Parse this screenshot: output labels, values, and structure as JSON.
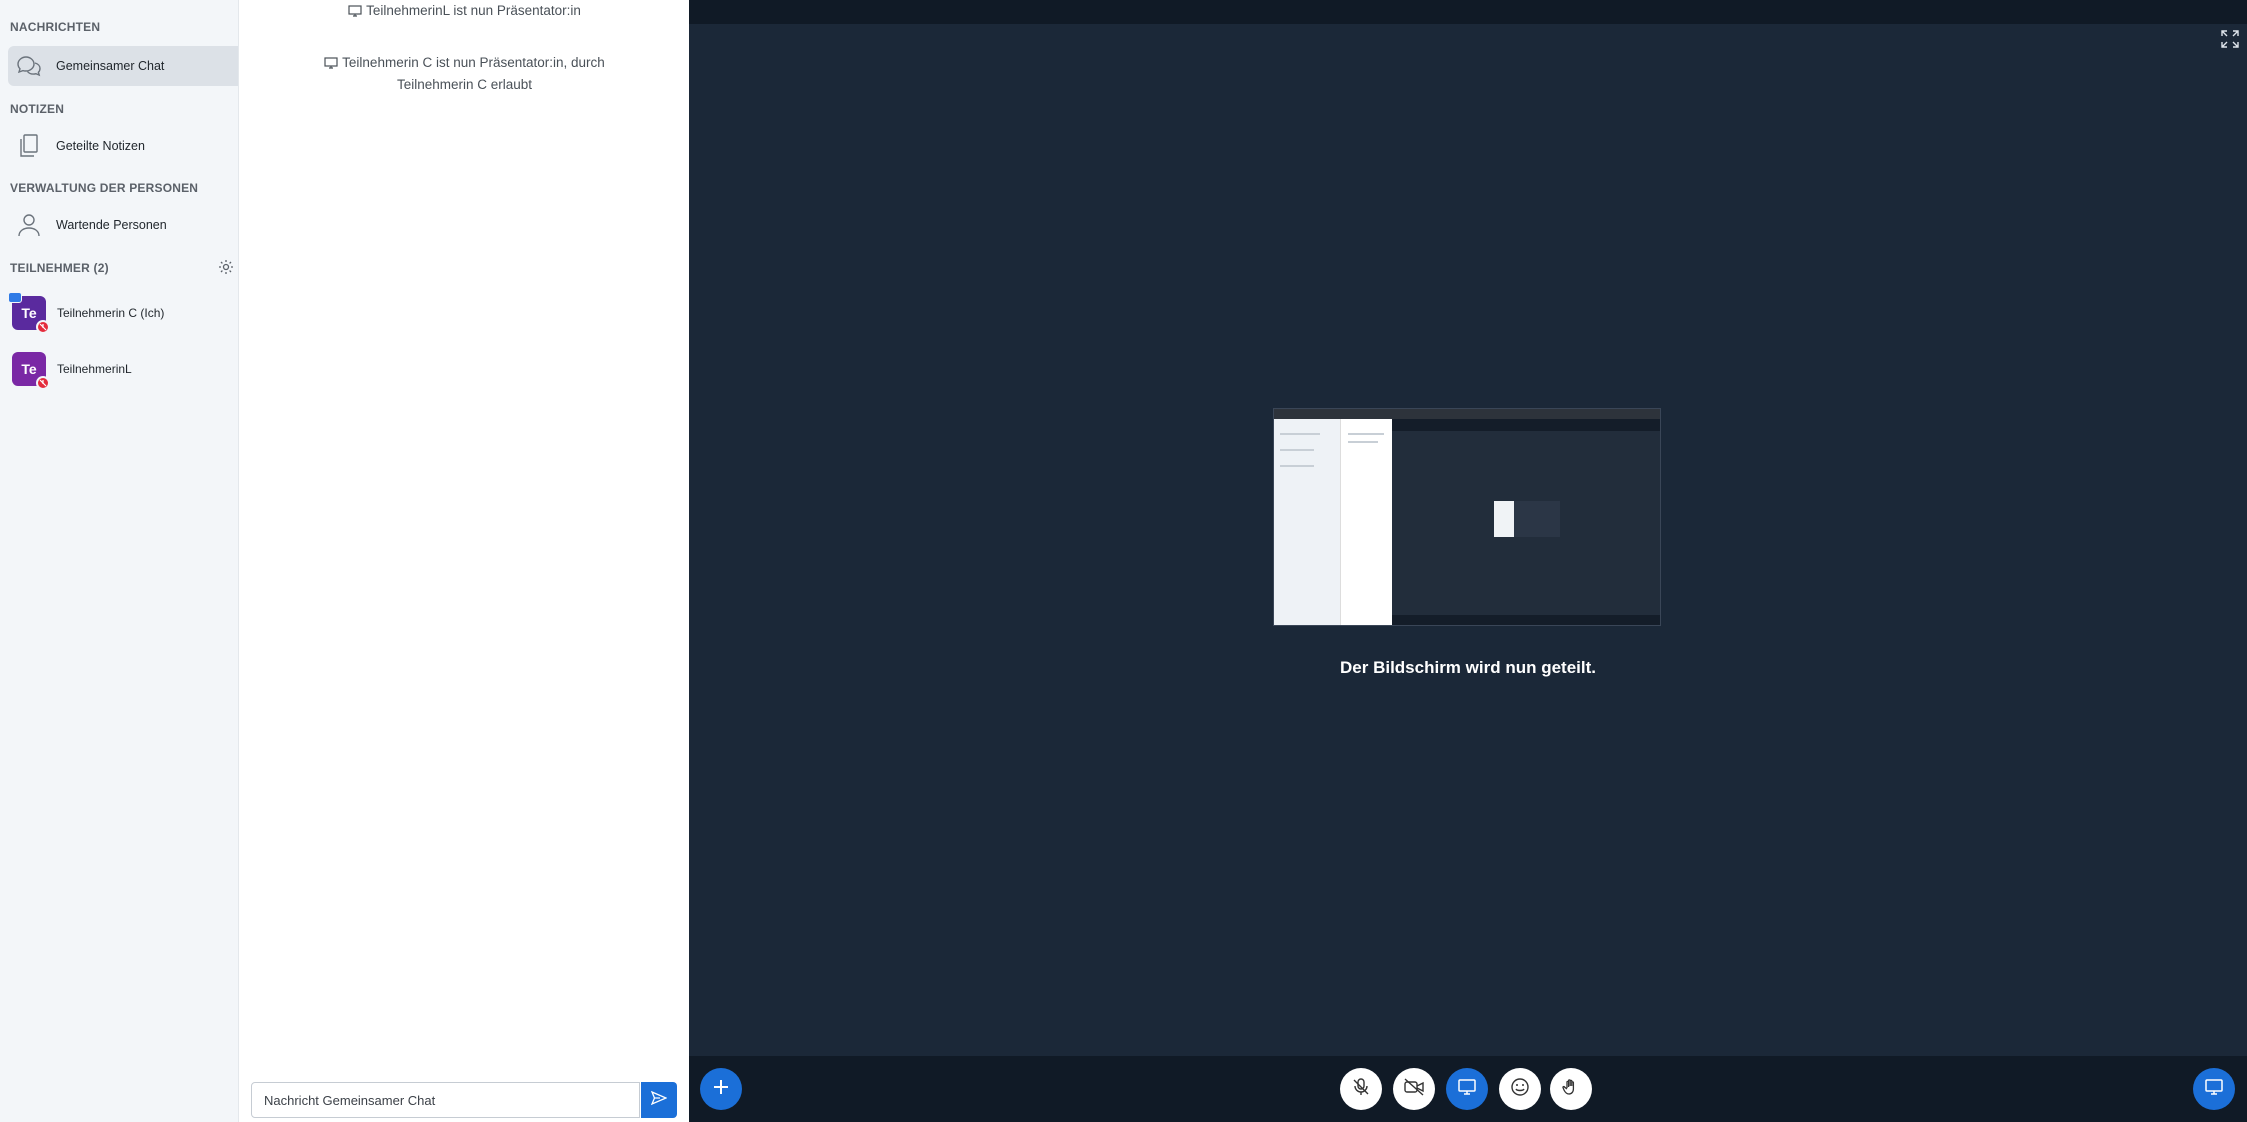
{
  "sidebar": {
    "messages_heading": "NACHRICHTEN",
    "public_chat": "Gemeinsamer Chat",
    "notes_heading": "NOTIZEN",
    "shared_notes": "Geteilte Notizen",
    "people_heading": "VERWALTUNG DER PERSONEN",
    "waiting_users": "Wartende Personen",
    "participants_heading": "TEILNEHMER (2)",
    "users": [
      {
        "initials": "Te",
        "name": "Teilnehmerin C (Ich)"
      },
      {
        "initials": "Te",
        "name": "TeilnehmerinL"
      }
    ]
  },
  "chat": {
    "messages": [
      "TeilnehmerinL ist nun Präsentator:in",
      "Teilnehmerin C ist nun Präsentator:in, durch",
      "Teilnehmerin C erlaubt"
    ],
    "input_placeholder": "Nachricht Gemeinsamer Chat"
  },
  "main": {
    "screenshare_status": "Der Bildschirm wird nun geteilt."
  },
  "colors": {
    "accent": "#1b6fd8",
    "main_bg": "#1b2838",
    "avatar": "#7a28a5"
  }
}
